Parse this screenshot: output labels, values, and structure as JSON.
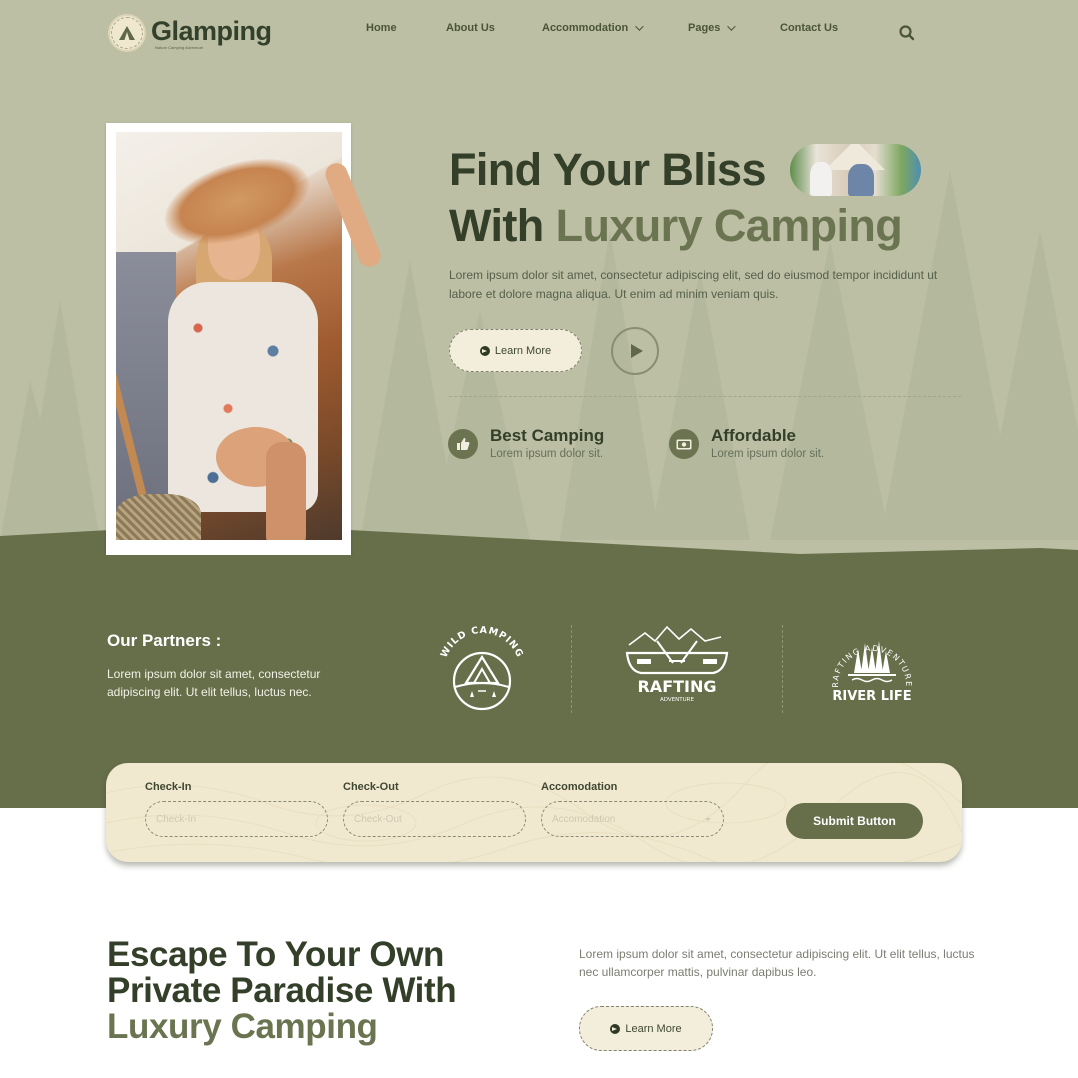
{
  "header": {
    "logo": {
      "name": "Glamping",
      "badge_text": "Adventure",
      "tagline": "Nature Camping Adventure"
    },
    "nav": [
      {
        "label": "Home",
        "has_dropdown": false
      },
      {
        "label": "About Us",
        "has_dropdown": false
      },
      {
        "label": "Accommodation",
        "has_dropdown": true
      },
      {
        "label": "Pages",
        "has_dropdown": true
      },
      {
        "label": "Contact Us",
        "has_dropdown": false
      }
    ],
    "search_icon": "search-icon"
  },
  "hero": {
    "title_line1": "Find Your Bliss",
    "title_line2_plain": "With ",
    "title_line2_accent": "Luxury Camping",
    "description": "Lorem ipsum dolor sit amet, consectetur adipiscing elit, sed do eiusmod tempor incididunt ut labore et dolore magna aliqua. Ut enim ad minim veniam quis.",
    "learn_more_label": "Learn More",
    "play_icon": "play-icon",
    "features": [
      {
        "icon": "thumbs-up-icon",
        "title": "Best Camping",
        "description": "Lorem ipsum dolor sit."
      },
      {
        "icon": "money-icon",
        "title": "Affordable",
        "description": "Lorem ipsum dolor sit."
      }
    ]
  },
  "partners": {
    "title": "Our Partners :",
    "description": "Lorem ipsum dolor sit amet, consectetur adipiscing elit. Ut elit tellus, luctus nec.",
    "logos": [
      {
        "name": "Wild Camping",
        "arc_text": "WILD CAMPING"
      },
      {
        "name": "Rafting Adventure",
        "main_text": "RAFTING",
        "sub_text": "ADVENTURE"
      },
      {
        "name": "River Life",
        "arc_text": "RAFTING ADVENTURE",
        "main_text": "RIVER LIFE"
      }
    ]
  },
  "booking": {
    "fields": [
      {
        "label": "Check-In",
        "placeholder": "Check-In",
        "value": ""
      },
      {
        "label": "Check-Out",
        "placeholder": "Check-Out",
        "value": ""
      },
      {
        "label": "Accomodation",
        "placeholder": "Accomodation",
        "value": ""
      }
    ],
    "submit_label": "Submit Button"
  },
  "escape": {
    "title_line1": "Escape To Your Own",
    "title_line2": "Private Paradise With",
    "title_line3": "Luxury Camping",
    "description": "Lorem ipsum dolor sit amet, consectetur adipiscing elit. Ut elit tellus, luctus nec ullamcorper mattis, pulvinar dapibus leo.",
    "learn_more_label": "Learn More"
  },
  "colors": {
    "hero_bg": "#bcbfa3",
    "olive": "#666e4a",
    "accent_text": "#6a7450",
    "dark_text": "#333f28",
    "cream": "#f1e9cf"
  }
}
